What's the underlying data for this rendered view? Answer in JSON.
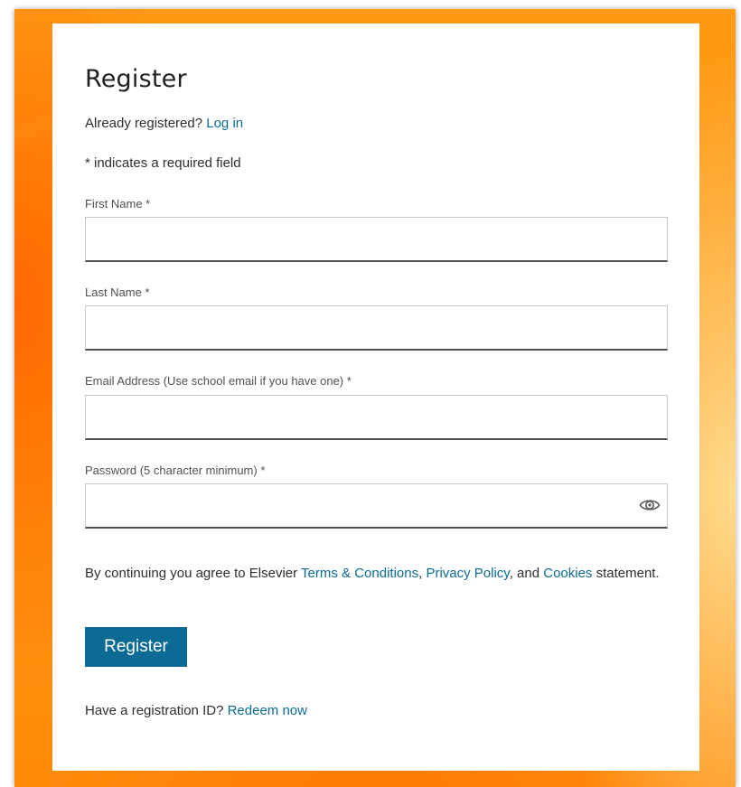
{
  "form": {
    "title": "Register",
    "already_text": "Already registered? ",
    "login_link": "Log in",
    "required_note": "* indicates a required field",
    "fields": [
      {
        "label": "First Name *",
        "value": "",
        "placeholder": ""
      },
      {
        "label": "Last Name *",
        "value": "",
        "placeholder": ""
      },
      {
        "label": "Email Address (Use school email if you have one) *",
        "value": "",
        "placeholder": ""
      },
      {
        "label": "Password (5 character minimum) *",
        "value": "",
        "placeholder": ""
      }
    ],
    "agree": {
      "prefix": "By continuing you agree to Elsevier ",
      "terms_link": "Terms & Conditions",
      "sep1": ", ",
      "privacy_link": "Privacy Policy",
      "sep2": ", and ",
      "cookies_link": "Cookies",
      "suffix": " statement."
    },
    "submit_label": "Register",
    "registration_text": "Have a registration ID? ",
    "redeem_link": "Redeem now"
  },
  "icons": {
    "password_toggle": "eye-icon"
  },
  "colors": {
    "accent": "#0c6b94",
    "background": "#ff9410",
    "text": "#2e2e2e"
  }
}
